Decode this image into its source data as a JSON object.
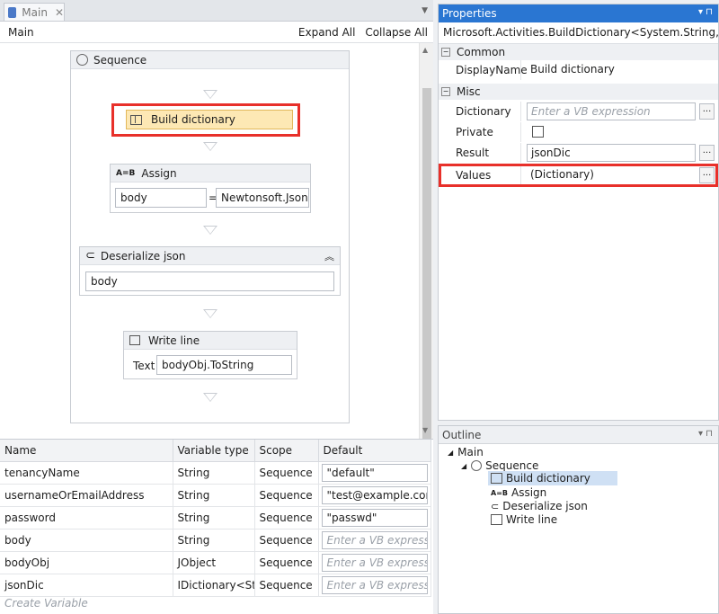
{
  "designer": {
    "tab_label": "Main",
    "breadcrumb": "Main",
    "expand_all": "Expand All",
    "collapse_all": "Collapse All"
  },
  "workflow": {
    "sequence_title": "Sequence",
    "build_dictionary": "Build dictionary",
    "assign": {
      "title": "Assign",
      "left": "body",
      "op": "=",
      "right": "Newtonsoft.Json.Js"
    },
    "deserialize": {
      "title": "Deserialize json",
      "value": "body"
    },
    "write_line": {
      "title": "Write line",
      "label": "Text",
      "value": "bodyObj.ToString"
    }
  },
  "variables": {
    "columns": [
      "Name",
      "Variable type",
      "Scope",
      "Default"
    ],
    "rows": [
      {
        "name": "tenancyName",
        "type": "String",
        "scope": "Sequence",
        "default": "\"default\"",
        "placeholder": false
      },
      {
        "name": "usernameOrEmailAddress",
        "type": "String",
        "scope": "Sequence",
        "default": "\"test@example.com\"",
        "placeholder": false
      },
      {
        "name": "password",
        "type": "String",
        "scope": "Sequence",
        "default": "\"passwd\"",
        "placeholder": false
      },
      {
        "name": "body",
        "type": "String",
        "scope": "Sequence",
        "default": "Enter a VB expression",
        "placeholder": true
      },
      {
        "name": "bodyObj",
        "type": "JObject",
        "scope": "Sequence",
        "default": "Enter a VB expression",
        "placeholder": true
      },
      {
        "name": "jsonDic",
        "type": "IDictionary<String",
        "scope": "Sequence",
        "default": "Enter a VB expression",
        "placeholder": true
      }
    ],
    "create_label": "Create Variable"
  },
  "properties": {
    "title": "Properties",
    "type_name": "Microsoft.Activities.BuildDictionary<System.String, System....",
    "common_label": "Common",
    "display_name_label": "DisplayName",
    "display_name_value": "Build dictionary",
    "misc_label": "Misc",
    "dictionary_label": "Dictionary",
    "dictionary_placeholder": "Enter a VB expression",
    "private_label": "Private",
    "result_label": "Result",
    "result_value": "jsonDic",
    "values_label": "Values",
    "values_value": "(Dictionary)",
    "ellipsis": "..."
  },
  "outline": {
    "title": "Outline",
    "items": [
      "Main",
      "Sequence",
      "Build dictionary",
      "Assign",
      "Deserialize json",
      "Write line"
    ]
  },
  "colors": {
    "accent": "#2a76d2",
    "highlight": "#e8302a",
    "selected": "#fde8b4"
  }
}
